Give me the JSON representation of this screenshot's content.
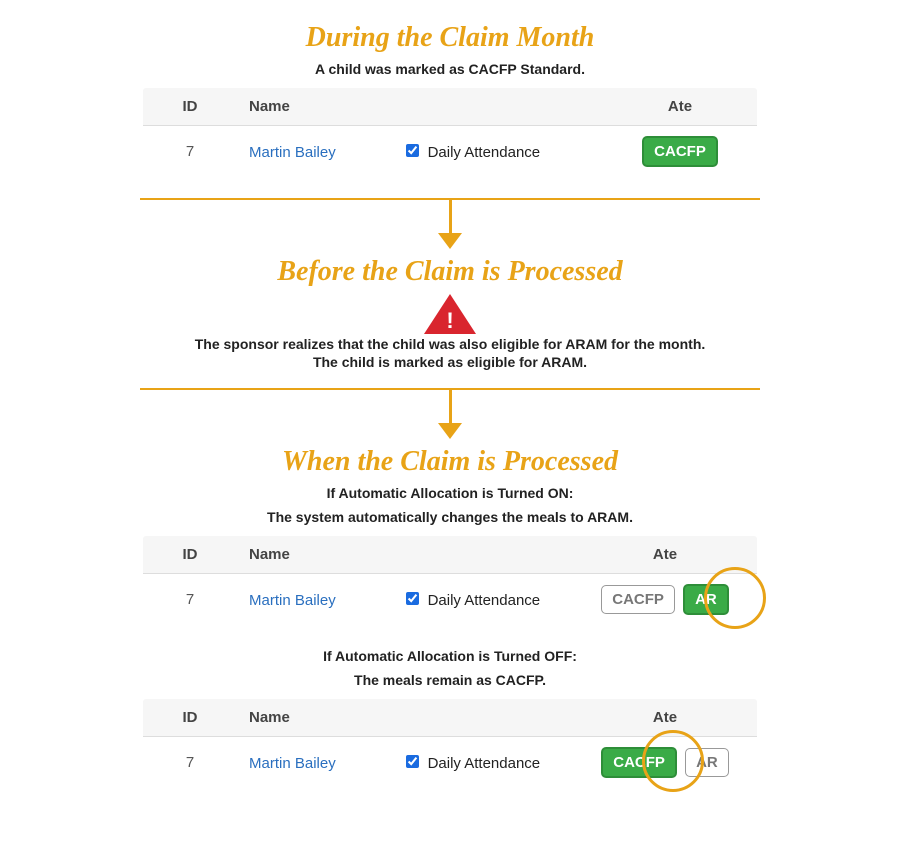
{
  "section1": {
    "heading": "During the Claim Month",
    "subtext": "A child was marked as CACFP Standard.",
    "table": {
      "headers": {
        "id": "ID",
        "name": "Name",
        "ate": "Ate"
      },
      "row": {
        "id": "7",
        "name": "Martin Bailey",
        "attendance_label": "Daily Attendance",
        "badge_text": "CACFP"
      }
    }
  },
  "section2": {
    "heading": "Before the Claim is Processed",
    "line1": "The sponsor realizes that the child was also eligible for ARAM for the month.",
    "line2": "The child is marked as eligible for ARAM."
  },
  "section3": {
    "heading": "When the Claim is Processed",
    "on_title": "If Automatic Allocation is Turned ON:",
    "on_sub": "The system automatically changes the meals to ARAM.",
    "on_table": {
      "headers": {
        "id": "ID",
        "name": "Name",
        "ate": "Ate"
      },
      "row": {
        "id": "7",
        "name": "Martin Bailey",
        "attendance_label": "Daily Attendance",
        "badge_left": "CACFP",
        "badge_right": "AR"
      }
    },
    "off_title": "If Automatic Allocation is Turned OFF:",
    "off_sub": "The meals remain as CACFP.",
    "off_table": {
      "headers": {
        "id": "ID",
        "name": "Name",
        "ate": "Ate"
      },
      "row": {
        "id": "7",
        "name": "Martin Bailey",
        "attendance_label": "Daily Attendance",
        "badge_left": "CACFP",
        "badge_right": "AR"
      }
    }
  }
}
